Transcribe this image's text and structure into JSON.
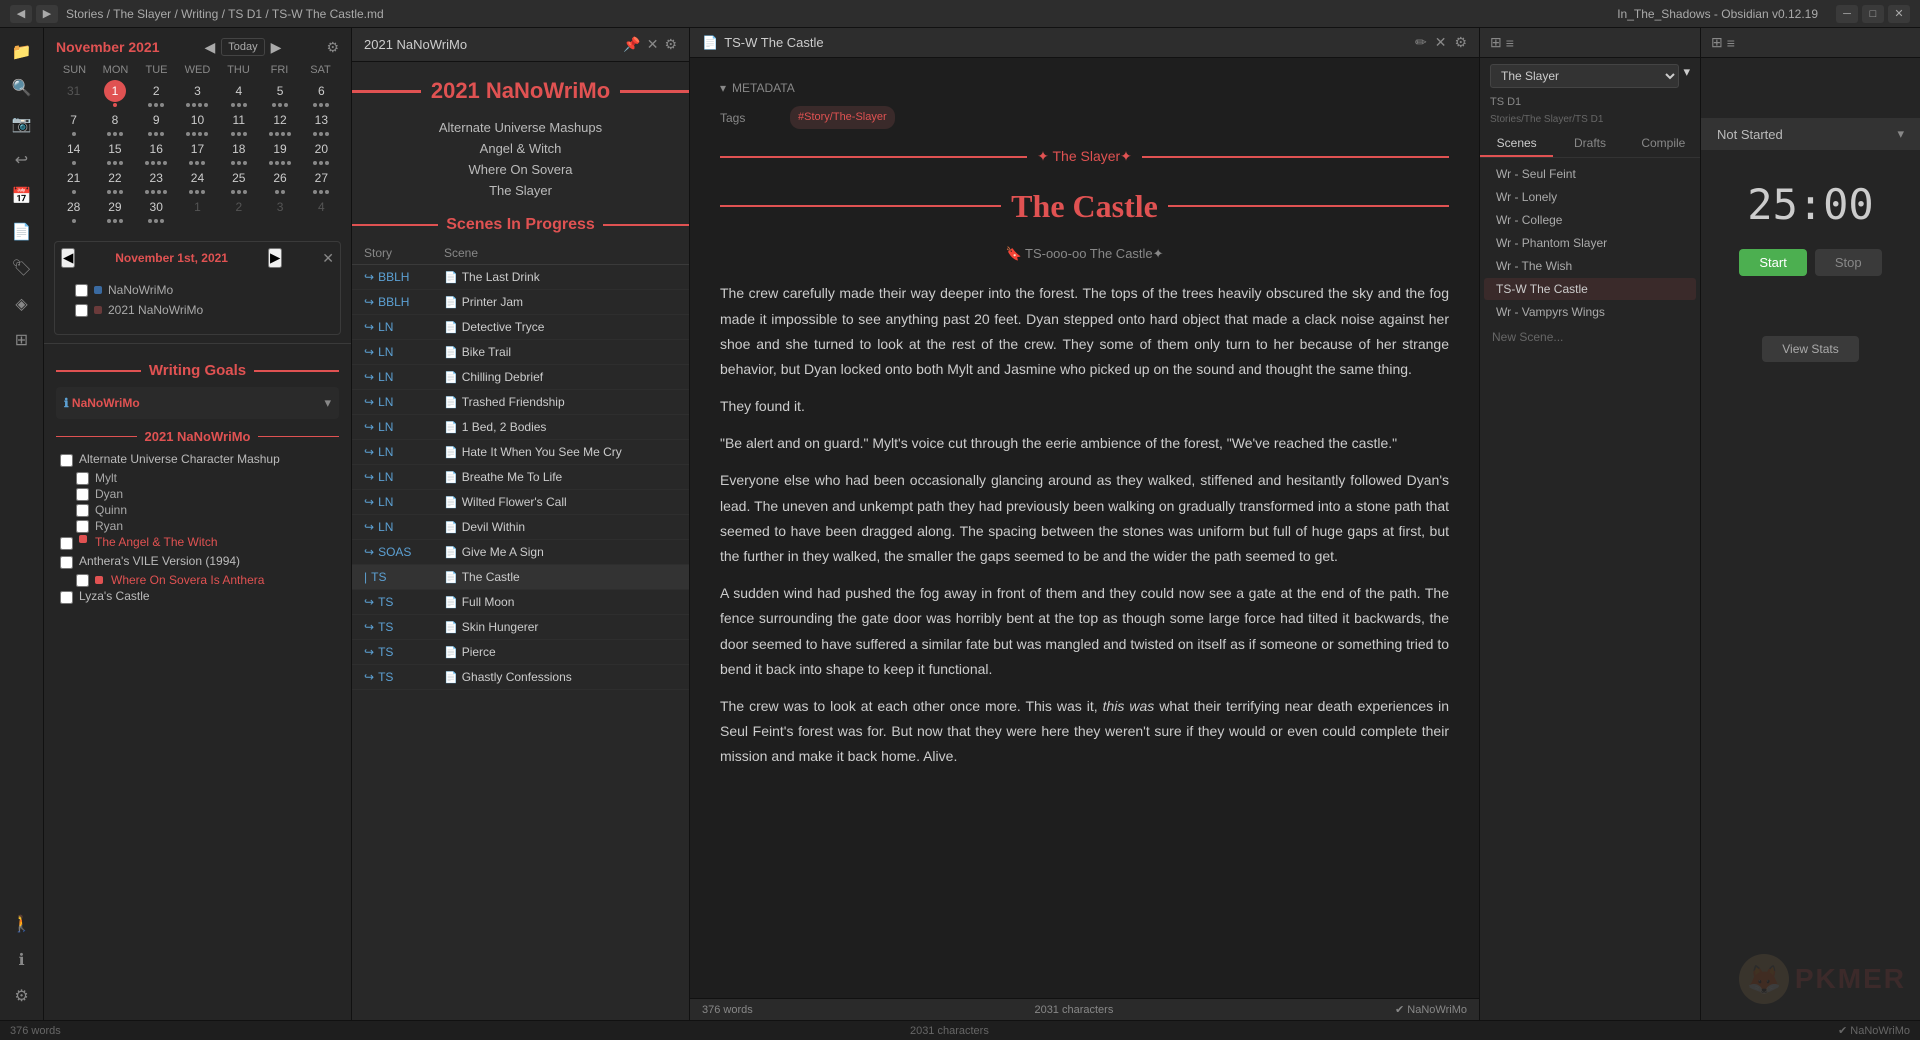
{
  "titlebar": {
    "path": "Stories / The Slayer / Writing / TS D1 / TS-W The Castle.md",
    "app": "In_The_Shadows - Obsidian v0.12.19",
    "nav_back": "◀",
    "nav_fwd": "▶",
    "win_min": "─",
    "win_max": "□",
    "win_close": "✕"
  },
  "calendar": {
    "month": "November 2021",
    "today_btn": "Today",
    "days_of_week": [
      "SUN",
      "MON",
      "TUE",
      "WED",
      "THU",
      "FRI",
      "SAT"
    ],
    "weeks": [
      [
        {
          "num": "31",
          "other": true,
          "dots": []
        },
        {
          "num": "1",
          "today": true,
          "dots": [
            "red"
          ]
        },
        {
          "num": "2",
          "dots": [
            "dot",
            "dot",
            "dot"
          ]
        },
        {
          "num": "3",
          "dots": [
            "dot",
            "dot",
            "dot",
            "dot"
          ]
        },
        {
          "num": "4",
          "dots": [
            "dot",
            "dot",
            "dot"
          ]
        },
        {
          "num": "5",
          "dots": [
            "dot",
            "dot",
            "dot"
          ]
        },
        {
          "num": "6",
          "dots": [
            "dot",
            "dot",
            "dot"
          ]
        }
      ],
      [
        {
          "num": "7",
          "dots": [
            "dot"
          ]
        },
        {
          "num": "8",
          "dots": [
            "dot",
            "dot",
            "dot"
          ]
        },
        {
          "num": "9",
          "dots": [
            "dot",
            "dot",
            "dot"
          ]
        },
        {
          "num": "10",
          "dots": [
            "dot",
            "dot",
            "dot",
            "dot"
          ]
        },
        {
          "num": "11",
          "dots": [
            "dot",
            "dot",
            "dot"
          ]
        },
        {
          "num": "12",
          "dots": [
            "dot",
            "dot",
            "dot",
            "dot"
          ]
        },
        {
          "num": "13",
          "dots": [
            "dot",
            "dot",
            "dot"
          ]
        }
      ],
      [
        {
          "num": "14",
          "dots": [
            "dot"
          ]
        },
        {
          "num": "15",
          "dots": [
            "dot",
            "dot",
            "dot"
          ]
        },
        {
          "num": "16",
          "dots": [
            "dot",
            "dot",
            "dot",
            "dot"
          ]
        },
        {
          "num": "17",
          "dots": [
            "dot",
            "dot",
            "dot"
          ]
        },
        {
          "num": "18",
          "dots": [
            "dot",
            "dot",
            "dot"
          ]
        },
        {
          "num": "19",
          "dots": [
            "dot",
            "dot",
            "dot",
            "dot"
          ]
        },
        {
          "num": "20",
          "dots": [
            "dot",
            "dot",
            "dot"
          ]
        }
      ],
      [
        {
          "num": "21",
          "dots": [
            "dot"
          ]
        },
        {
          "num": "22",
          "dots": [
            "dot",
            "dot",
            "dot"
          ]
        },
        {
          "num": "23",
          "dots": [
            "dot",
            "dot",
            "dot",
            "dot"
          ]
        },
        {
          "num": "24",
          "dots": [
            "dot",
            "dot",
            "dot"
          ]
        },
        {
          "num": "25",
          "dots": [
            "dot",
            "dot",
            "dot"
          ]
        },
        {
          "num": "26",
          "dots": [
            "dot",
            "dot"
          ]
        },
        {
          "num": "27",
          "dots": [
            "dot",
            "dot",
            "dot"
          ]
        }
      ],
      [
        {
          "num": "28",
          "dots": [
            "dot"
          ]
        },
        {
          "num": "29",
          "dots": [
            "dot",
            "dot",
            "dot"
          ]
        },
        {
          "num": "30",
          "dots": [
            "dot",
            "dot",
            "dot"
          ]
        },
        {
          "num": "1",
          "other": true,
          "dots": []
        },
        {
          "num": "2",
          "other": true,
          "dots": []
        },
        {
          "num": "3",
          "other": true,
          "dots": []
        },
        {
          "num": "4",
          "other": true,
          "dots": []
        }
      ]
    ],
    "mini_date": "November 1st, 2021",
    "tags": [
      {
        "label": "NaNoWriMo",
        "color": "#3a6aa0"
      },
      {
        "label": "2021 NaNoWriMo",
        "color": "#6a3a3a"
      }
    ]
  },
  "writing_goals": {
    "section_title": "Writing Goals",
    "nanowrimo_label": "NaNoWriMo",
    "goal_section": "2021 NaNoWriMo",
    "goals": [
      {
        "label": "Alternate Universe Character Mashup",
        "checked": false,
        "sub": []
      },
      {
        "label": "Mylt",
        "checked": false,
        "sub_indent": true
      },
      {
        "label": "Dyan",
        "checked": false,
        "sub_indent": true
      },
      {
        "label": "Quinn",
        "checked": false,
        "sub_indent": true
      },
      {
        "label": "Ryan",
        "checked": false,
        "sub_indent": true
      },
      {
        "label": "The Angel & The Witch",
        "checked": false,
        "is_link": true,
        "color": "#e05252"
      },
      {
        "label": "Anthera's VILE Version (1994)",
        "checked": false,
        "sub": []
      },
      {
        "label": "Where On Sovera Is Anthera",
        "checked": false,
        "is_link": true,
        "color": "#e05252"
      },
      {
        "label": "Lyza's Castle",
        "checked": false,
        "sub": []
      }
    ]
  },
  "scenes_panel": {
    "header": "2021 NaNoWriMo",
    "nanowrimo_title": "2021 NaNoWriMo",
    "sub_projects": [
      "Alternate Universe Mashups",
      "Angel & Witch",
      "Where On Sovera",
      "The Slayer"
    ],
    "scenes_in_progress": "Scenes In Progress",
    "col_story": "Story",
    "col_scene": "Scene",
    "scenes": [
      {
        "tag": "BBLH",
        "tag_class": "tag-bblh",
        "name": "The Last Drink",
        "active": false
      },
      {
        "tag": "BBLH",
        "tag_class": "tag-bblh",
        "name": "Printer Jam",
        "active": false
      },
      {
        "tag": "LN",
        "tag_class": "tag-ln",
        "name": "Detective Tryce",
        "active": false
      },
      {
        "tag": "LN",
        "tag_class": "tag-ln",
        "name": "Bike Trail",
        "active": false
      },
      {
        "tag": "LN",
        "tag_class": "tag-ln",
        "name": "Chilling Debrief",
        "active": false
      },
      {
        "tag": "LN",
        "tag_class": "tag-ln",
        "name": "Trashed Friendship",
        "active": false
      },
      {
        "tag": "LN",
        "tag_class": "tag-ln",
        "name": "1 Bed, 2 Bodies",
        "active": false
      },
      {
        "tag": "LN",
        "tag_class": "tag-ln",
        "name": "Hate It When You See Me Cry",
        "active": false
      },
      {
        "tag": "LN",
        "tag_class": "tag-ln",
        "name": "Breathe Me To Life",
        "active": false
      },
      {
        "tag": "LN",
        "tag_class": "tag-ln",
        "name": "Wilted Flower's Call",
        "active": false
      },
      {
        "tag": "LN",
        "tag_class": "tag-ln",
        "name": "Devil Within",
        "active": false
      },
      {
        "tag": "SOAS",
        "tag_class": "tag-soas",
        "name": "Give Me A Sign",
        "active": false
      },
      {
        "tag": "TS",
        "tag_class": "tag-ts",
        "name": "The Castle",
        "active": true
      },
      {
        "tag": "TS",
        "tag_class": "tag-ts",
        "name": "Full Moon",
        "active": false
      },
      {
        "tag": "TS",
        "tag_class": "tag-ts",
        "name": "Skin Hungerer",
        "active": false
      },
      {
        "tag": "TS",
        "tag_class": "tag-ts",
        "name": "Pierce",
        "active": false
      },
      {
        "tag": "TS",
        "tag_class": "tag-ts",
        "name": "Ghastly Confessions",
        "active": false
      }
    ]
  },
  "editor": {
    "tab_title": "TS-W The Castle",
    "metadata_label": "METADATA",
    "tags_label": "Tags",
    "tag_value": "#Story/The-Slayer",
    "story_banner": "✦ The Slayer✦",
    "castle_title": "The Castle",
    "scene_id": "🔖 TS-ooo-oo The Castle✦",
    "body_paragraphs": [
      "The crew carefully made their way deeper into the forest. The tops of the trees heavily obscured the sky and the fog made it impossible to see anything past 20 feet. Dyan stepped onto hard object that made a clack noise against her shoe and she turned to look at the rest of the crew. They some of them only turn to her because of her strange behavior, but Dyan locked onto both Mylt and Jasmine who picked up on the sound and thought the same thing.",
      "They found it.",
      "\"Be alert and on guard.\" Mylt's voice cut through the eerie ambience of the forest, \"We've reached the castle.\"",
      "Everyone else who had been occasionally glancing around as they walked, stiffened and hesitantly followed Dyan's lead. The uneven and unkempt path they had previously been walking on gradually transformed into a stone path that seemed to have been dragged along. The spacing between the stones was uniform but full of huge gaps at first, but the further in they walked, the smaller the gaps seemed to be and the wider the path seemed to get.",
      "A sudden wind had pushed the fog away in front of them and they could now see a gate at the end of the path. The fence surrounding the gate door was horribly bent at the top as though some large force had tilted it backwards, the door seemed to have suffered a similar fate but was mangled and twisted on itself as if someone or something tried to bend it back into shape to keep it functional.",
      "The crew was to look at each other once more. This was it, this was what their terrifying near death experiences in Seul Feint's forest was for. But now that they were here they weren't sure if they would or even could complete their mission and make it back home. Alive."
    ],
    "footer_words": "376 words",
    "footer_chars": "2031 characters",
    "footer_plugin": "✔ NaNoWriMo"
  },
  "outline": {
    "header_title": "",
    "project_title": "The Slayer",
    "sub_title": "TS D1",
    "path": "Stories/The Slayer/TS D1",
    "tabs": [
      "Scenes",
      "Drafts",
      "Compile"
    ],
    "scenes": [
      "Wr - Seul Feint",
      "Wr - Lonely",
      "Wr - College",
      "Wr - Phantom Slayer",
      "Wr - The Wish",
      "TS-W The Castle",
      "Wr - Vampyrs Wings"
    ],
    "active_scene": "TS-W The Castle",
    "new_scene": "New Scene..."
  },
  "pomodoro": {
    "status": "Not Started",
    "timer": "25:00",
    "start_btn": "Start",
    "stop_btn": "Stop",
    "view_stats_btn": "View Stats"
  },
  "icons": {
    "folder": "📁",
    "search": "🔍",
    "camera": "📷",
    "arrow_left": "↩",
    "calendar": "📅",
    "file": "📄",
    "pencil": "✏",
    "pin": "📌",
    "close": "✕",
    "settings": "⚙",
    "panel": "⊞",
    "chevron_right": "▶",
    "chevron_left": "◀",
    "chevron_down": "▾",
    "tag_icon": "🏷",
    "bookmark": "🔖",
    "person_walking": "🚶",
    "info": "ℹ",
    "star": "★",
    "graph": "◈"
  }
}
